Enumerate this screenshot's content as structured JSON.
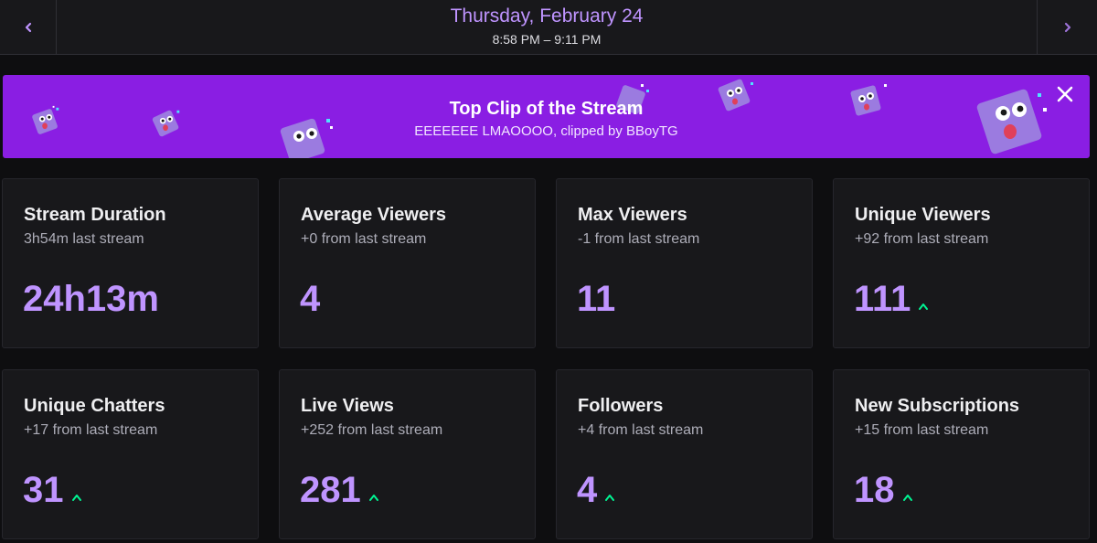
{
  "header": {
    "date": "Thursday, February 24",
    "time_range": "8:58 PM – 9:11 PM",
    "prev_icon": "chevron-left-icon",
    "next_icon": "chevron-right-icon"
  },
  "banner": {
    "title": "Top Clip of the Stream",
    "subtitle": "EEEEEEE LMAOOOO, clipped by BBoyTG",
    "background": "#8a1ee3",
    "close_icon": "close-icon",
    "mascot_icon": "glitch-mascot-icon"
  },
  "colors": {
    "accent": "#bf94ff",
    "trend_up": "#00f593",
    "card_bg": "#18181b",
    "page_bg": "#0e0e10"
  },
  "stats": [
    {
      "title": "Stream Duration",
      "subtitle": "3h54m last stream",
      "value": "24h13m",
      "trend": "none"
    },
    {
      "title": "Average Viewers",
      "subtitle": "+0 from last stream",
      "value": "4",
      "trend": "none"
    },
    {
      "title": "Max Viewers",
      "subtitle": "-1 from last stream",
      "value": "11",
      "trend": "none"
    },
    {
      "title": "Unique Viewers",
      "subtitle": "+92 from last stream",
      "value": "111",
      "trend": "up"
    },
    {
      "title": "Unique Chatters",
      "subtitle": "+17 from last stream",
      "value": "31",
      "trend": "up"
    },
    {
      "title": "Live Views",
      "subtitle": "+252 from last stream",
      "value": "281",
      "trend": "up"
    },
    {
      "title": "Followers",
      "subtitle": "+4 from last stream",
      "value": "4",
      "trend": "up"
    },
    {
      "title": "New Subscriptions",
      "subtitle": "+15 from last stream",
      "value": "18",
      "trend": "up"
    }
  ]
}
